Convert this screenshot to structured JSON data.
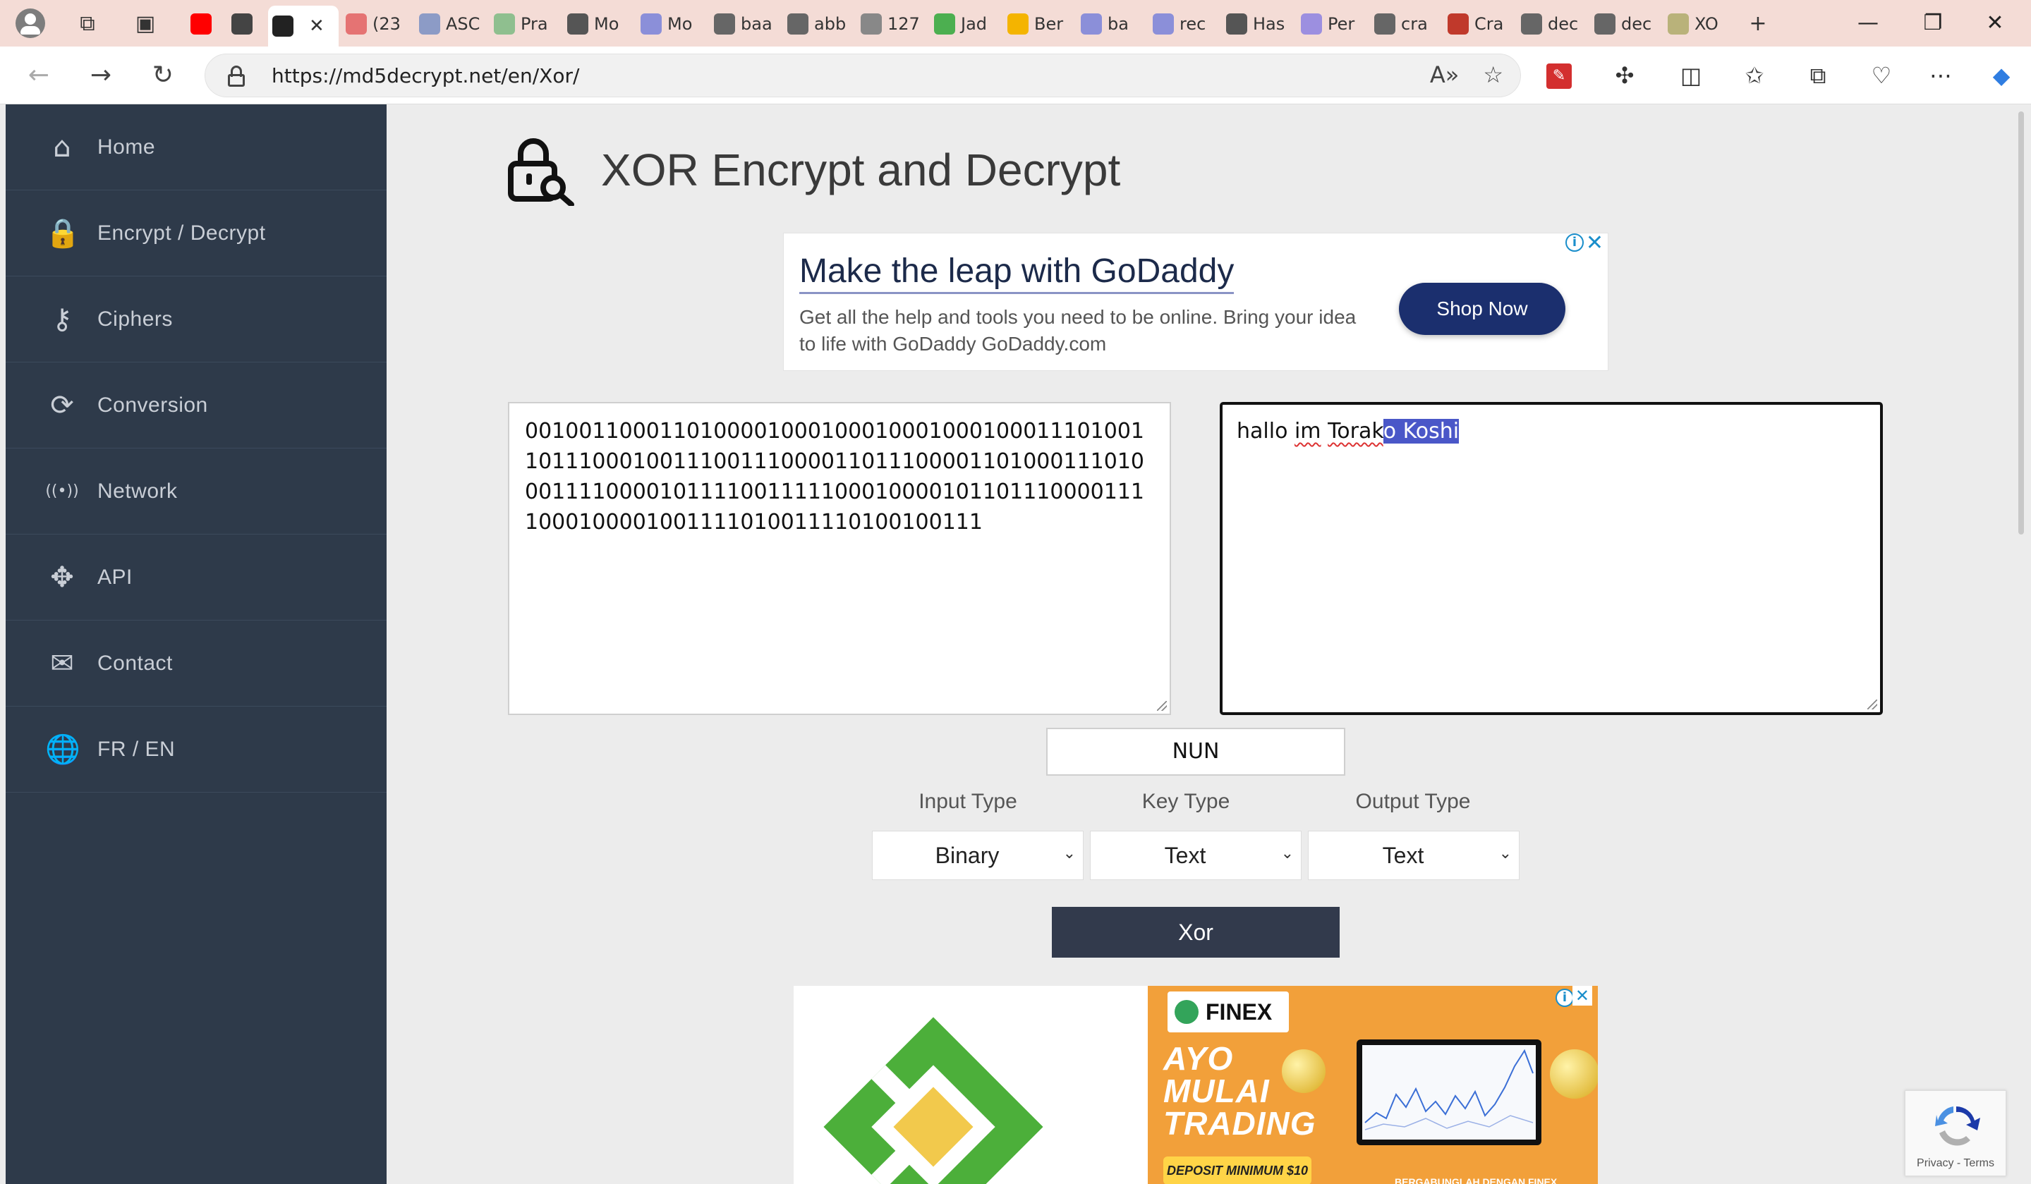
{
  "browser": {
    "tabs": [
      {
        "label": "",
        "icon": "youtube-icon",
        "color": "#ff0000"
      },
      {
        "label": "",
        "icon": "speaker-icon",
        "color": "#444444"
      },
      {
        "label": "",
        "icon": "lock-search-icon",
        "color": "#222222",
        "active": true
      },
      {
        "label": "(23",
        "icon": "youtube-icon",
        "color": "#e57373"
      },
      {
        "label": "ASC",
        "icon": "globe-icon",
        "color": "#8c9bc6"
      },
      {
        "label": "Pra",
        "icon": "leaf-icon",
        "color": "#8fbf8f"
      },
      {
        "label": "Mo",
        "icon": "github-icon",
        "color": "#555555"
      },
      {
        "label": "Mo",
        "icon": "doc-icon",
        "color": "#8b8fd9"
      },
      {
        "label": "baa",
        "icon": "search-icon",
        "color": "#666666"
      },
      {
        "label": "abb",
        "icon": "search-icon",
        "color": "#666666"
      },
      {
        "label": "127",
        "icon": "page-icon",
        "color": "#888888"
      },
      {
        "label": "Jad",
        "icon": "sheet-icon",
        "color": "#4caf50"
      },
      {
        "label": "Ber",
        "icon": "drive-icon",
        "color": "#f4b400"
      },
      {
        "label": "ba",
        "icon": "doc-icon",
        "color": "#8b8fd9"
      },
      {
        "label": "rec",
        "icon": "doc-icon",
        "color": "#8b8fd9"
      },
      {
        "label": "Has",
        "icon": "github-icon",
        "color": "#555555"
      },
      {
        "label": "Per",
        "icon": "circle-icon",
        "color": "#9c8fe0"
      },
      {
        "label": "cra",
        "icon": "search-icon",
        "color": "#666666"
      },
      {
        "label": "Cra",
        "icon": "d-icon",
        "color": "#c0392b"
      },
      {
        "label": "dec",
        "icon": "search-icon",
        "color": "#666666"
      },
      {
        "label": "dec",
        "icon": "search-icon",
        "color": "#666666"
      },
      {
        "label": "XO",
        "icon": "bar-icon",
        "color": "#b9b27a"
      }
    ],
    "url": "https://md5decrypt.net/en/Xor/"
  },
  "sidebar": {
    "items": [
      {
        "label": "Home",
        "icon": "home-icon",
        "glyph": "⌂"
      },
      {
        "label": "Encrypt / Decrypt",
        "icon": "lock-icon",
        "glyph": "🔒"
      },
      {
        "label": "Ciphers",
        "icon": "key-icon",
        "glyph": "⚷"
      },
      {
        "label": "Conversion",
        "icon": "refresh-icon",
        "glyph": "⟳"
      },
      {
        "label": "Network",
        "icon": "broadcast-icon",
        "glyph": "((•))"
      },
      {
        "label": "API",
        "icon": "arrows-icon",
        "glyph": "✥"
      },
      {
        "label": "Contact",
        "icon": "mail-icon",
        "glyph": "✉"
      },
      {
        "label": "FR / EN",
        "icon": "globe-icon",
        "glyph": "🌐"
      }
    ]
  },
  "main": {
    "title": "XOR Encrypt and Decrypt",
    "input_text": "0010011000110100001000100010001000100011101001101110001001110011100001101110000110100011101000111100001011110011111000100001011011100001111000100001001111010011110100100111",
    "output_before": "hallo ",
    "output_im": "im",
    "output_space": " ",
    "output_tora": "Torak",
    "output_selected": "o Koshi",
    "key_value": "NUN",
    "input_type_label": "Input Type",
    "key_type_label": "Key Type",
    "output_type_label": "Output Type",
    "input_type_value": "Binary",
    "key_type_value": "Text",
    "output_type_value": "Text",
    "xor_button": "Xor"
  },
  "ads": {
    "top": {
      "title": "Make the leap with GoDaddy",
      "body": "Get all the help and tools you need to be online. Bring your idea to life with GoDaddy GoDaddy.com",
      "button": "Shop Now"
    },
    "bottom": {
      "brand": "FINEX",
      "headline_1": "AYO",
      "headline_2": "MULAI",
      "headline_3": "TRADING",
      "pill": "DEPOSIT MINIMUM $10",
      "footer": "BERGABUNGLAH DENGAN FINEX"
    }
  },
  "recaptcha": {
    "text": "Privacy - Terms"
  }
}
